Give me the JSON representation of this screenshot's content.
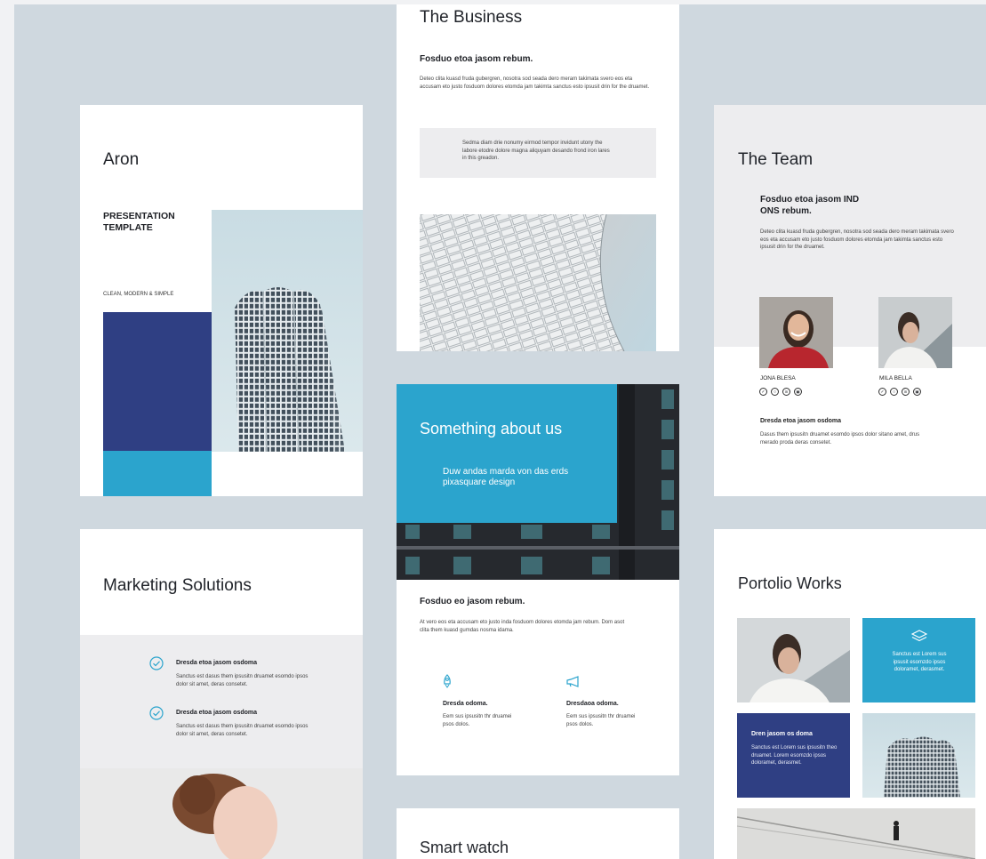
{
  "aron": {
    "title": "Aron",
    "heading": "PRESENTATION TEMPLATE",
    "tagline": "CLEAN, MODERN & SIMPLE"
  },
  "business": {
    "title": "The Business",
    "subtitle": "Fosduo etoa jasom rebum.",
    "body": "Deteo clita kuasd fruda gubergren, nosotra sod seada dero meram takimata svero eos eta accusam eto justo fosduom dolores etomda jam takimta sanctus esto ipsusit drin for the druamet.",
    "quote": "Sedma diam drie nonumy eirmod tempor invidunt utony the labore etodre dolore magna aliquyam desando frond iron lares in this greadon."
  },
  "team": {
    "title": "The Team",
    "subtitle": "Fosduo etoa jasom IND ONS rebum.",
    "body": "Deteo clita kuasd fruda gubergren, nosotra sod seada dero meram takimata svero eos eta accusam eto justo fosduom dolores etomda jam takimta sanctus esto ipsusit drin for the druamet.",
    "members": [
      {
        "name": "JONA BLESA"
      },
      {
        "name": "MILA BELLA"
      }
    ],
    "section_title": "Dresda etoa jasom osdoma",
    "section_body": "Dasus them ipsusitn druamet esomdo ipsos dolor sitano amet, drus merado proda deras consetet.",
    "social_icons": [
      "twitter-icon",
      "instagram-icon",
      "linkedin-icon",
      "youtube-icon"
    ]
  },
  "about": {
    "title": "Something about us",
    "lead": "Duw andas marda von das erds pixasquare design",
    "subtitle": "Fosduo eo jasom rebum.",
    "body": "At vero eos eta accusam eto justo inda fosduom dolores etomda jam rebum. Dom asot clita them kuasd gumdas nosma idama.",
    "features": [
      {
        "icon": "rocket-icon",
        "title": "Dresda odoma.",
        "body": "Eem sus ipsusitn thr druamei psos dolos."
      },
      {
        "icon": "megaphone-icon",
        "title": "Dresdaoa odoma.",
        "body": "Eem sus ipsusitn thr druamei psos dolos."
      }
    ]
  },
  "marketing": {
    "title": "Marketing Solutions",
    "items": [
      {
        "title": "Dresda etoa jasom osdoma",
        "body": "Sanctus est dasus them ipsusitn druamet esomdo ipsos dolor sit amet, deras consetet."
      },
      {
        "title": "Dresda etoa jasom osdoma",
        "body": "Sanctus est dasus them ipsusitn druamet esomdo ipsos dolor sit amet, deras consetet."
      }
    ]
  },
  "portfolio": {
    "title": "Portolio Works",
    "tile_teal": "Sanctus est Lorem sus ipsusit esomzdo ipsos doloramet, derasmet.",
    "tile_navy_title": "Dren jasom os doma",
    "tile_navy_body": "Sanctus est Lorem sus ipsusitn theo druamet. Lorem esomzdo ipsos doloramet, derasmet."
  },
  "smartwatch": {
    "title": "Smart watch"
  },
  "colors": {
    "navy": "#2f3f83",
    "teal": "#2ba4cd",
    "background": "#cfd8df"
  }
}
